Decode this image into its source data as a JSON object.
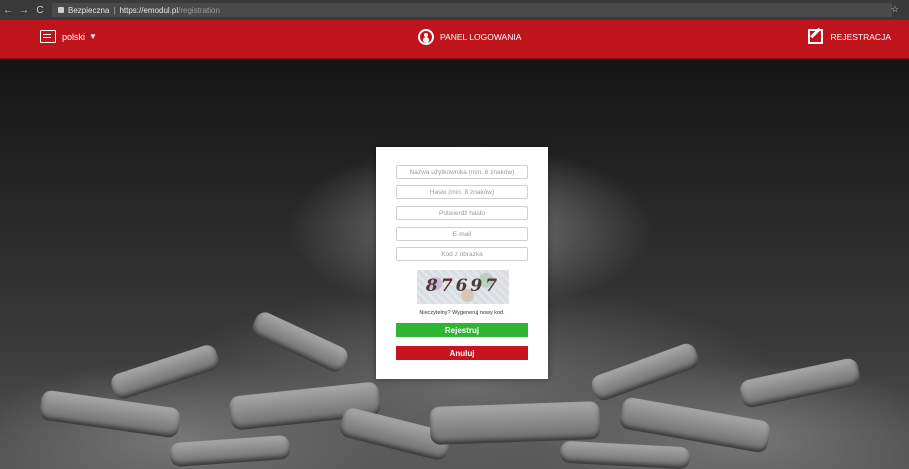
{
  "browser": {
    "back": "←",
    "forward": "→",
    "reload": "C",
    "secure_label": "Bezpieczna",
    "separator": "|",
    "url_host": "https://emodul.pl",
    "url_path": "/registration",
    "bookmark_star": "☆"
  },
  "header": {
    "language": "polski",
    "language_caret": "▼",
    "login_panel": "PANEL LOGOWANIA",
    "register": "REJESTRACJA",
    "bar_color": "#c0141c"
  },
  "form": {
    "username_placeholder": "Nazwa użytkownika (min. 6 znaków)",
    "password_placeholder": "Hasło (min. 8 znaków)",
    "confirm_placeholder": "Potwierdź hasło",
    "email_placeholder": "E-mail",
    "code_placeholder": "Kod z obrazka",
    "captcha_digits": [
      "8",
      "7",
      "6",
      "9",
      "7"
    ],
    "refresh_text": "Nieczytelny? Wygeneruj nowy kod.",
    "submit_label": "Rejestruj",
    "cancel_label": "Anuluj",
    "submit_color": "#2fb532",
    "cancel_color": "#c81320"
  }
}
